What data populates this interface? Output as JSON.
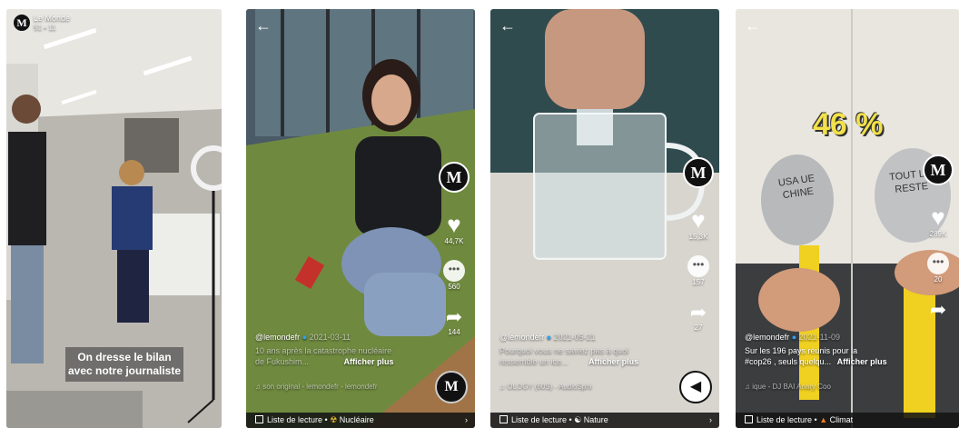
{
  "panels": [
    {
      "brand": "Le Monde",
      "brand_sub": "51 • 11",
      "caption_line1": "On dresse le bilan",
      "caption_line2": "avec notre journaliste"
    },
    {
      "likes": "44,7K",
      "comments": "560",
      "shares": "144",
      "username": "@lemondefr",
      "date": "2021-03-11",
      "desc_line1": "10 ans après la catastrophe nucléaire",
      "desc_line2": "de Fukushim...",
      "more_label": "Afficher plus",
      "music": "son original - lemondefr - lemondefr",
      "playlist_label": "Liste de lecture",
      "playlist_name": "Nucléaire"
    },
    {
      "likes": "15,3K",
      "comments": "157",
      "shares": "27",
      "username": "@lemondefr",
      "date": "2021-05-21",
      "desc_line1": "Pourquoi vous ne saviez pas à quoi",
      "desc_line2": "ressemble un ice...",
      "more_label": "Afficher plus",
      "music": "OLOGY (60S) - AudioSphi",
      "playlist_label": "Liste de lecture",
      "playlist_name": "Nature"
    },
    {
      "overlay": "46 %",
      "balloon_left": "USA UE CHINE",
      "balloon_right": "TOUT LE RESTE",
      "likes": "289K",
      "comments": "20",
      "username": "@lemondefr",
      "date": "2021-11-09",
      "desc_line1": "Sur les 196 pays réunis pour la",
      "desc_line2": "#cop26 , seuls quelqu...",
      "more_label": "Afficher plus",
      "music": "ique - DJ BAI  Anary Coo",
      "playlist_label": "Liste de lecture",
      "playlist_name": "Climat"
    }
  ]
}
